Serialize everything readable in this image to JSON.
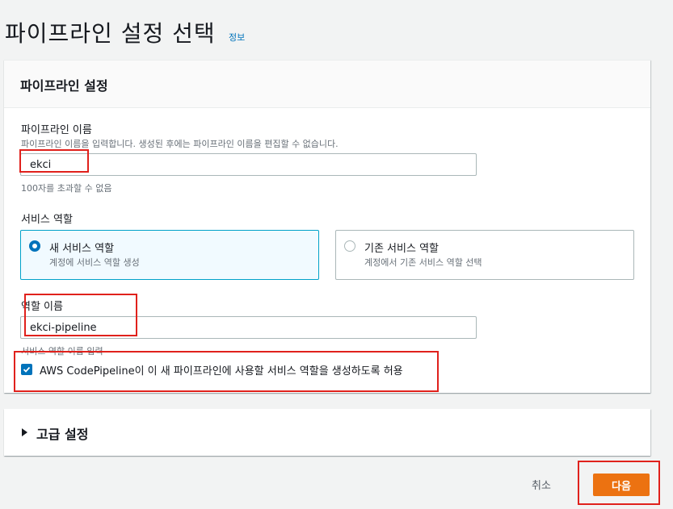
{
  "page": {
    "title": "파이프라인 설정 선택",
    "info_link": "정보"
  },
  "pipeline_settings": {
    "header": "파이프라인 설정",
    "pipeline_name": {
      "label": "파이프라인 이름",
      "description": "파이프라인 이름을 입력합니다. 생성된 후에는 파이프라인 이름을 편집할 수 없습니다.",
      "value": "ekci",
      "constraint": "100자를 초과할 수 없음"
    },
    "service_role": {
      "label": "서비스 역할",
      "options": [
        {
          "title": "새 서비스 역할",
          "description": "계정에 서비스 역할 생성",
          "selected": true
        },
        {
          "title": "기존 서비스 역할",
          "description": "계정에서 기존 서비스 역할 선택",
          "selected": false
        }
      ]
    },
    "role_name": {
      "label": "역할 이름",
      "value": "ekci-pipeline",
      "constraint": "서비스 역할 이름 입력"
    },
    "allow_checkbox": {
      "label": "AWS CodePipeline이 이 새 파이프라인에 사용할 서비스 역할을 생성하도록 허용",
      "checked": true
    }
  },
  "advanced_settings": {
    "title": "고급 설정"
  },
  "footer": {
    "cancel_label": "취소",
    "next_label": "다음"
  },
  "colors": {
    "accent": "#0073bb",
    "primary_button": "#ec7211",
    "highlight": "#e0211c"
  },
  "icons": {
    "caret": "caret-right-icon",
    "check": "checkmark-icon"
  }
}
